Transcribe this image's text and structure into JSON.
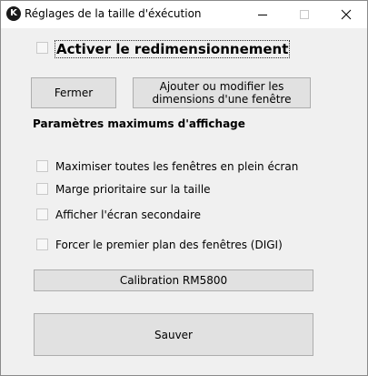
{
  "window": {
    "title": "Réglages de la taille d'éxécution",
    "icon": "k-logo-icon",
    "controls": [
      "minimize-icon",
      "maximize-icon",
      "close-icon"
    ]
  },
  "enable_resize": {
    "label": "Activer le redimensionnement",
    "checked": false
  },
  "buttons": {
    "close": "Fermer",
    "add_modify": "Ajouter ou modifier les dimensions d'une fenêtre",
    "calibration": "Calibration RM5800",
    "save": "Sauver"
  },
  "max_display": {
    "heading": "Paramètres maximums d'affichage",
    "options": [
      {
        "label": "Maximiser toutes les fenêtres en plein écran",
        "checked": false
      },
      {
        "label": "Marge prioritaire sur la taille",
        "checked": false
      },
      {
        "label": "Afficher l'écran secondaire",
        "checked": false
      },
      {
        "label": "Forcer le premier plan des fenêtres (DIGI)",
        "checked": false
      }
    ]
  }
}
